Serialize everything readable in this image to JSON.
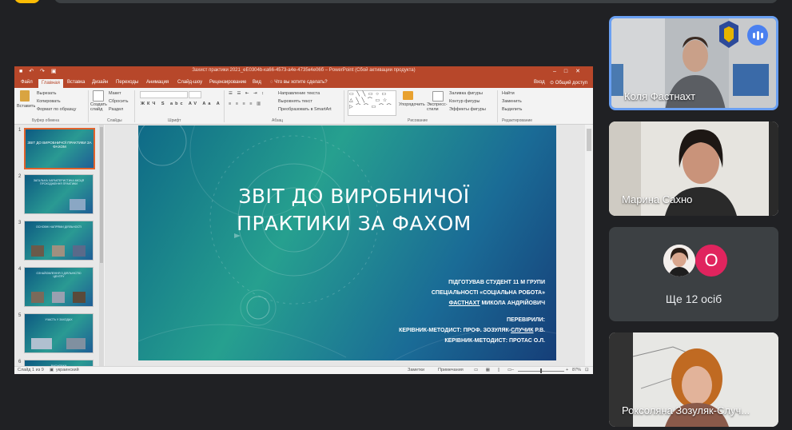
{
  "window": {
    "title": "Захист практики 2021_еЕ0304b-ка66-4573-а4е-4735к4е06б – PowerPoint (Сбой активации продукта)",
    "qat_icons": [
      "save-icon",
      "undo-icon",
      "redo-icon",
      "slideshow-icon"
    ],
    "controls": [
      "minimize-icon",
      "maximize-icon",
      "close-icon"
    ]
  },
  "tabs": [
    {
      "label": "Файл"
    },
    {
      "label": "Главная"
    },
    {
      "label": "Вставка"
    },
    {
      "label": "Дизайн"
    },
    {
      "label": "Переходы"
    },
    {
      "label": "Анимация"
    },
    {
      "label": "Слайд-шоу"
    },
    {
      "label": "Рецензирование"
    },
    {
      "label": "Вид"
    },
    {
      "label": "Что вы хотите сделать?"
    }
  ],
  "account": {
    "signin": "Вход",
    "share": "Общий доступ"
  },
  "ribbon": {
    "paste": "Вставить",
    "cut": "Вырезать",
    "copy": "Копировать",
    "format_painter": "Формат по образцу",
    "new_slide": "Создать слайд",
    "layout": "Макет",
    "reset": "Сбросить",
    "section": "Раздел",
    "text_direction": "Направление текста",
    "align_text": "Выровнять текст",
    "smartart": "Преобразовать в SmartArt",
    "arrange": "Упорядочить",
    "quick_styles": "Экспресс-стили",
    "shape_fill": "Заливка фигуры",
    "shape_outline": "Контур фигуры",
    "shape_effects": "Эффекты фигуры",
    "find": "Найти",
    "replace": "Заменить",
    "select": "Выделить",
    "groups": {
      "clipboard": "Буфер обмена",
      "slides": "Слайды",
      "font": "Шрифт",
      "paragraph": "Абзац",
      "drawing": "Рисование",
      "editing": "Редактирование"
    }
  },
  "thumbnails": [
    {
      "num": "1",
      "title": "ЗВІТ ДО ВИРОБНИЧОЇ ПРАКТИКИ ЗА ФАХОМ"
    },
    {
      "num": "2",
      "title": "ЗАГАЛЬНА ХАРАКТЕРИСТИКА МІСЦЯ ПРОХОДЖЕННЯ ПРАКТИКИ"
    },
    {
      "num": "3",
      "title": "ОСНОВНІ НАПРЯМИ ДІЯЛЬНОСТІ"
    },
    {
      "num": "4",
      "title": "ОЗНАЙОМЛЕННЯ З ДІЯЛЬНІСТЮ ЦЕНТРУ"
    },
    {
      "num": "5",
      "title": "УЧАСТЬ У ЗАХОДАХ"
    },
    {
      "num": "6",
      "title": "ВИСНОВКИ"
    }
  ],
  "slide": {
    "title_line1": "ЗВІТ ДО ВИРОБНИЧОЇ",
    "title_line2": "ПРАКТИКИ ЗА ФАХОМ",
    "prepared_by": "ПІДГОТУВАВ СТУДЕНТ 11 М ГРУПИ",
    "specialty": "СПЕЦІАЛЬНОСТІ «СОЦІАЛЬНА РОБОТА»",
    "student_surname": "ФАСТНАХТ",
    "student_name": " МИКОЛА АНДРІЙОВИЧ",
    "checked": "ПЕРЕВІРИЛИ:",
    "supervisor1_pre": "КЕРІВНИК-МЕТОДИСТ: ПРОФ. ЗОЗУЛЯК-",
    "supervisor1_u": "СЛУЧИК",
    "supervisor1_post": " Р.В.",
    "supervisor2": "КЕРІВНИК-МЕТОДИСТ: ПРОТАС О.Л."
  },
  "status": {
    "slide_counter": "Слайд 1 из 9",
    "language": "украинский",
    "notes": "Заметки",
    "comments": "Примечания",
    "zoom": "87%"
  },
  "participants": [
    {
      "name": "Коля Фастнахт",
      "speaking": true
    },
    {
      "name": "Марина Сахно",
      "speaking": false
    },
    {
      "more_label": "Ще 12 осіб",
      "avatar_letter": "O",
      "avatar_color": "#e0245e"
    },
    {
      "name": "Роксоляна Зозуляк-Случ..."
    }
  ],
  "colors": {
    "ppt_accent": "#b7472a",
    "meet_bg": "#202124",
    "speaking_ring": "#6aa0f2"
  }
}
